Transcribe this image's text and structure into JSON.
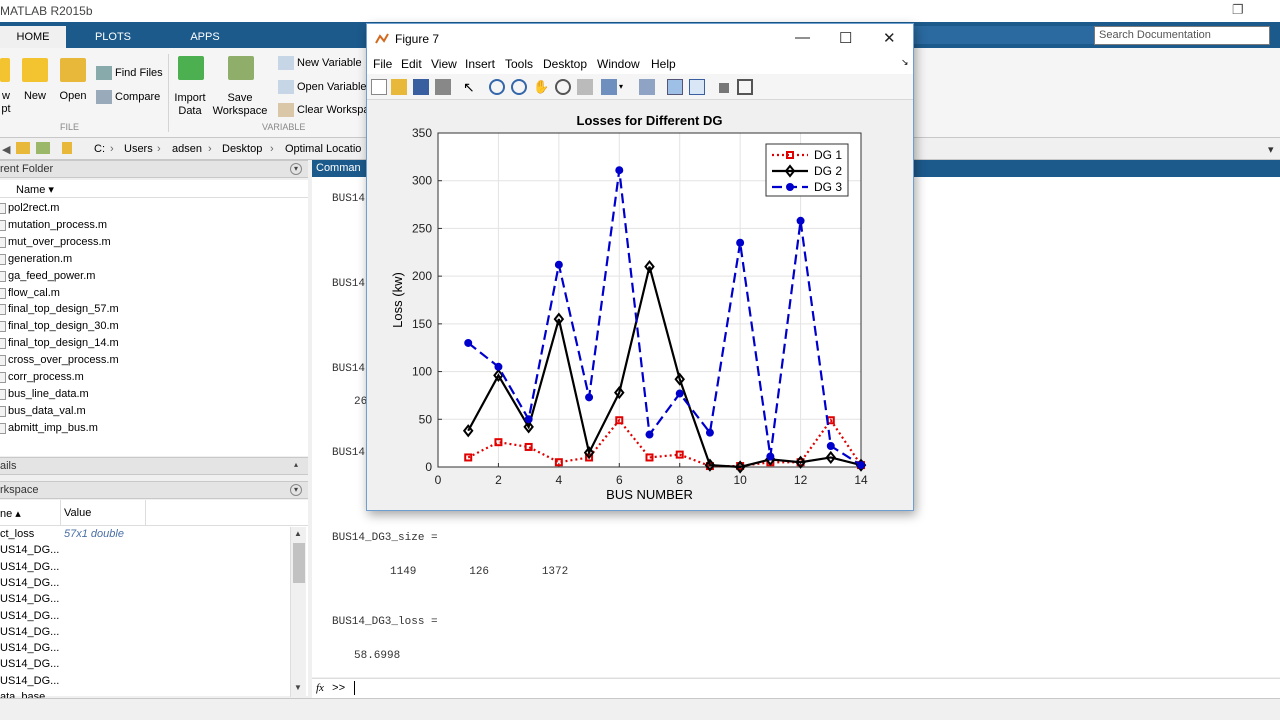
{
  "app": {
    "title": "MATLAB R2015b",
    "restore_glyph": "❐"
  },
  "tabs": [
    {
      "label": "HOME"
    },
    {
      "label": "PLOTS"
    },
    {
      "label": "APPS"
    }
  ],
  "ribbon": {
    "new_script": "w\npt",
    "new": "New",
    "open": "Open",
    "find_files": "Find Files",
    "compare": "Compare",
    "import_data": "Import\nData",
    "save_workspace": "Save\nWorkspace",
    "new_variable": "New Variable",
    "open_variable": "Open Variable",
    "clear_workspace": "Clear Workspa",
    "group_file": "FILE",
    "group_variable": "VARIABLE"
  },
  "search": {
    "placeholder": "Search Documentation"
  },
  "address": {
    "drive": "C:",
    "parts": [
      "Users",
      "adsen",
      "Desktop",
      "Optimal Locatio"
    ]
  },
  "current_folder": {
    "header": "rent Folder",
    "column": "Name ▾",
    "files": [
      "pol2rect.m",
      "mutation_process.m",
      "mut_over_process.m",
      "generation.m",
      "ga_feed_power.m",
      "flow_cal.m",
      "final_top_design_57.m",
      "final_top_design_30.m",
      "final_top_design_14.m",
      "cross_over_process.m",
      "corr_process.m",
      "bus_line_data.m",
      "bus_data_val.m",
      "abmitt_imp_bus.m"
    ]
  },
  "details": {
    "header": "ails"
  },
  "workspace": {
    "header": "rkspace",
    "col_name": "ne ▴",
    "col_value": "Value",
    "rows": [
      {
        "name": "ct_loss",
        "value": "57x1 double"
      },
      {
        "name": "US14_DG...",
        "value": ""
      },
      {
        "name": "US14_DG...",
        "value": ""
      },
      {
        "name": "US14_DG...",
        "value": ""
      },
      {
        "name": "US14_DG...",
        "value": ""
      },
      {
        "name": "US14_DG...",
        "value": ""
      },
      {
        "name": "US14_DG...",
        "value": ""
      },
      {
        "name": "US14_DG...",
        "value": ""
      },
      {
        "name": "US14_DG...",
        "value": ""
      },
      {
        "name": "US14_DG...",
        "value": ""
      },
      {
        "name": "ata_base",
        "value": ""
      }
    ]
  },
  "command_window": {
    "header": "Comman",
    "lines": [
      {
        "text": "BUS14",
        "top": 16,
        "left": 20
      },
      {
        "text": "BUS14",
        "top": 101,
        "left": 20
      },
      {
        "text": "BUS14",
        "top": 186,
        "left": 20
      },
      {
        "text": "26",
        "top": 219,
        "left": 42
      },
      {
        "text": "BUS14",
        "top": 270,
        "left": 20
      },
      {
        "text": "BUS14_DG3_size =",
        "top": 355,
        "left": 20
      },
      {
        "text": "1149        126        1372",
        "top": 389,
        "left": 78
      },
      {
        "text": "BUS14_DG3_loss =",
        "top": 439,
        "left": 20
      },
      {
        "text": "58.6998",
        "top": 473,
        "left": 42
      }
    ],
    "prompt": ">>",
    "fx": "fx"
  },
  "figure": {
    "title": "Figure 7",
    "menu": [
      "File",
      "Edit",
      "View",
      "Insert",
      "Tools",
      "Desktop",
      "Window",
      "Help"
    ],
    "controls": {
      "minimize": "—",
      "maximize": "☐",
      "close": "✕"
    }
  },
  "chart_data": {
    "type": "line",
    "title": "Losses for Different DG",
    "xlabel": "BUS NUMBER",
    "ylabel": "Loss (kw)",
    "xlim": [
      0,
      14
    ],
    "ylim": [
      0,
      350
    ],
    "xticks": [
      0,
      2,
      4,
      6,
      8,
      10,
      12,
      14
    ],
    "yticks": [
      0,
      50,
      100,
      150,
      200,
      250,
      300,
      350
    ],
    "grid": true,
    "legend": "top-right",
    "x": [
      1,
      2,
      3,
      4,
      5,
      6,
      7,
      8,
      9,
      10,
      11,
      12,
      13,
      14
    ],
    "series": [
      {
        "name": "DG 1",
        "color": "#e00000",
        "dash": "2,3",
        "marker": "square",
        "values": [
          10,
          26,
          21,
          5,
          10,
          49,
          10,
          13,
          1,
          1,
          5,
          5,
          49,
          2
        ]
      },
      {
        "name": "DG 2",
        "color": "#000000",
        "dash": "",
        "marker": "diamond",
        "values": [
          38,
          96,
          42,
          155,
          15,
          78,
          210,
          92,
          2,
          0,
          8,
          5,
          10,
          2
        ]
      },
      {
        "name": "DG 3",
        "color": "#0000cc",
        "dash": "10,5",
        "marker": "circle",
        "values": [
          130,
          105,
          50,
          212,
          73,
          311,
          34,
          77,
          36,
          235,
          11,
          258,
          22,
          2
        ]
      }
    ]
  }
}
